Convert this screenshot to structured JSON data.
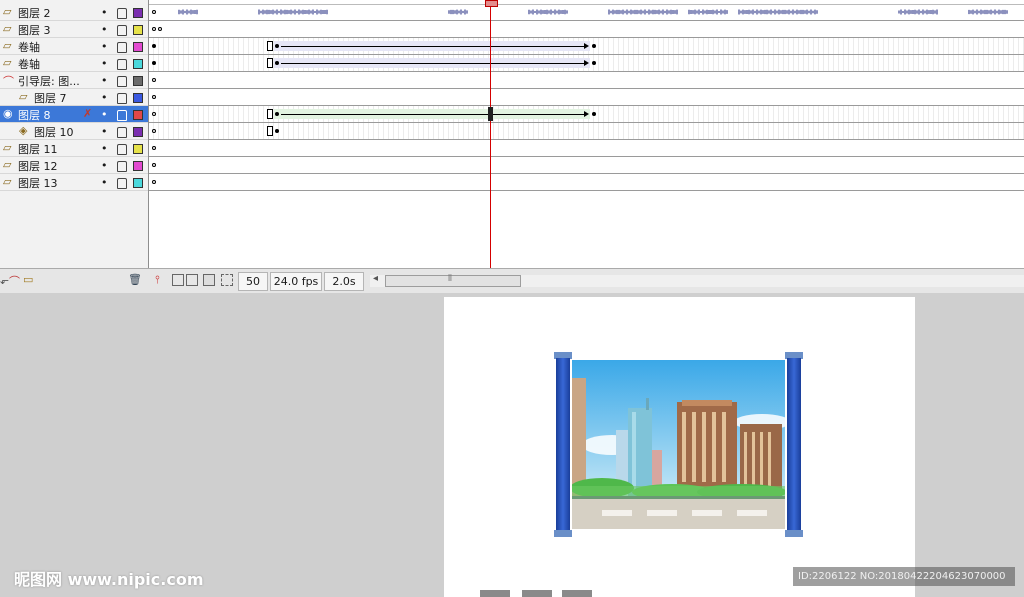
{
  "layers": [
    {
      "name": "图层 2",
      "type": "sound",
      "color": "#7b2fb0"
    },
    {
      "name": "图层 3",
      "type": "normal",
      "color": "#e6e24a"
    },
    {
      "name": "卷轴",
      "type": "normal",
      "color": "#e24ad0"
    },
    {
      "name": "卷轴",
      "type": "normal",
      "color": "#4ad8dc"
    },
    {
      "name": "引导层: 图...",
      "type": "guide",
      "color": "#6b6b6b"
    },
    {
      "name": "图层 7",
      "type": "guided",
      "color": "#3a58e0"
    },
    {
      "name": "图层 8",
      "type": "mask",
      "color": "#e04848",
      "selected": true
    },
    {
      "name": "图层 10",
      "type": "masked",
      "color": "#7b2fb0"
    },
    {
      "name": "图层 11",
      "type": "normal",
      "color": "#e6e24a"
    },
    {
      "name": "图层 12",
      "type": "normal",
      "color": "#e24ad0"
    },
    {
      "name": "图层 13",
      "type": "normal",
      "color": "#4ad8dc"
    }
  ],
  "toolbar": {
    "current_frame": "50",
    "frame_rate": "24.0 fps",
    "elapsed_time": "2.0s"
  },
  "watermark": "昵图网 www.nipic.com",
  "image_id": "ID:2206122 NO:20180422204623070000"
}
